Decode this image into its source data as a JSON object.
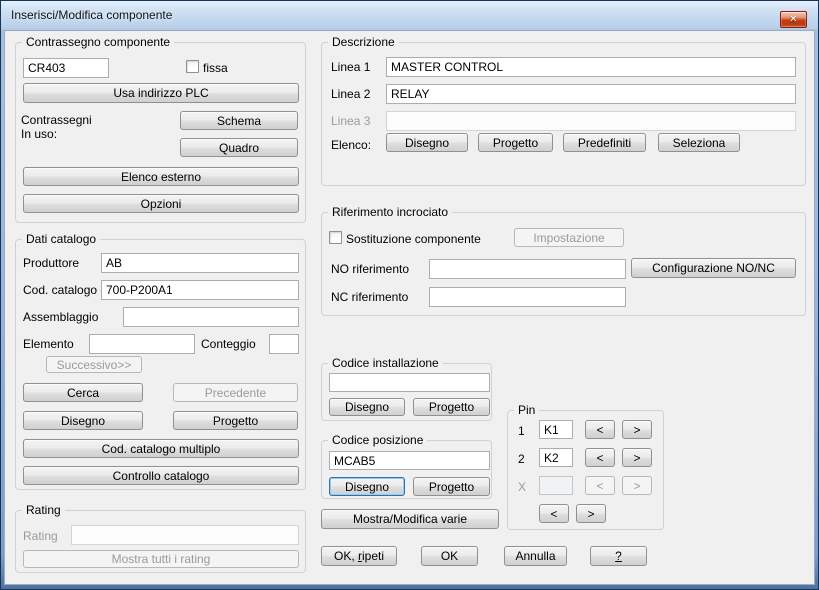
{
  "window": {
    "title": "Inserisci/Modifica componente",
    "close_glyph": "✕"
  },
  "colors": {
    "dialog_bg": "#f0f0f0",
    "titlebar_blue": "#b9cfe9",
    "frame_border": "#16335d",
    "close_button_red": "#c23f17",
    "focus_ring_blue": "#2c70b0",
    "disabled_text": "#9a9a9a"
  },
  "component_tag": {
    "group_label": "Contrassegno componente",
    "tag_value": "CR403",
    "fixed_checkbox_label": "fissa",
    "use_plc_button": "Usa indirizzo PLC",
    "tags_in_use_label": "Contrassegni\nIn uso:",
    "schema_button": "Schema",
    "quadro_button": "Quadro",
    "external_list_button": "Elenco esterno",
    "options_button": "Opzioni"
  },
  "catalog": {
    "group_label": "Dati catalogo",
    "manufacturer_label": "Produttore",
    "manufacturer_value": "AB",
    "catalog_code_label": "Cod. catalogo",
    "catalog_code_value": "700-P200A1",
    "assembly_label": "Assemblaggio",
    "assembly_value": "",
    "item_label": "Elemento",
    "item_value": "",
    "count_label": "Conteggio",
    "count_value": "",
    "next_button": "Successivo>>",
    "search_button": "Cerca",
    "previous_button": "Precedente",
    "drawing_button": "Disegno",
    "project_button": "Progetto",
    "multiple_catalog_button": "Cod. catalogo multiplo",
    "catalog_check_button": "Controllo catalogo"
  },
  "rating": {
    "group_label": "Rating",
    "field_label": "Rating",
    "field_value": "",
    "show_all_button": "Mostra tutti i rating"
  },
  "description": {
    "group_label": "Descrizione",
    "line1_label": "Linea 1",
    "line1_value": "MASTER CONTROL",
    "line2_label": "Linea 2",
    "line2_value": "RELAY",
    "line3_label": "Linea 3",
    "line3_value": "",
    "list_label": "Elenco:",
    "drawing_button": "Disegno",
    "project_button": "Progetto",
    "defaults_button": "Predefiniti",
    "select_button": "Seleziona"
  },
  "cross_reference": {
    "group_label": "Riferimento incrociato",
    "substitute_checkbox_label": "Sostituzione componente",
    "setup_button": "Impostazione",
    "no_ref_label": "NO riferimento",
    "no_ref_value": "",
    "nc_ref_label": "NC riferimento",
    "nc_ref_value": "",
    "config_button": "Configurazione NO/NC"
  },
  "installation_code": {
    "group_label": "Codice installazione",
    "value": "",
    "drawing_button": "Disegno",
    "project_button": "Progetto"
  },
  "location_code": {
    "group_label": "Codice posizione",
    "value": "MCAB5",
    "drawing_button": "Disegno",
    "project_button": "Progetto"
  },
  "pins": {
    "group_label": "Pin",
    "rows": [
      {
        "label": "1",
        "value": "K1"
      },
      {
        "label": "2",
        "value": "K2"
      },
      {
        "label": "X",
        "value": ""
      }
    ],
    "left_arrow": "<",
    "right_arrow": ">"
  },
  "footer": {
    "show_edit_misc_button": "Mostra/Modifica varie",
    "ok_repeat_pre": "OK, ",
    "ok_repeat_key": "r",
    "ok_repeat_post": "ipeti",
    "ok_button": "OK",
    "cancel_button": "Annulla",
    "help_button": "?"
  }
}
